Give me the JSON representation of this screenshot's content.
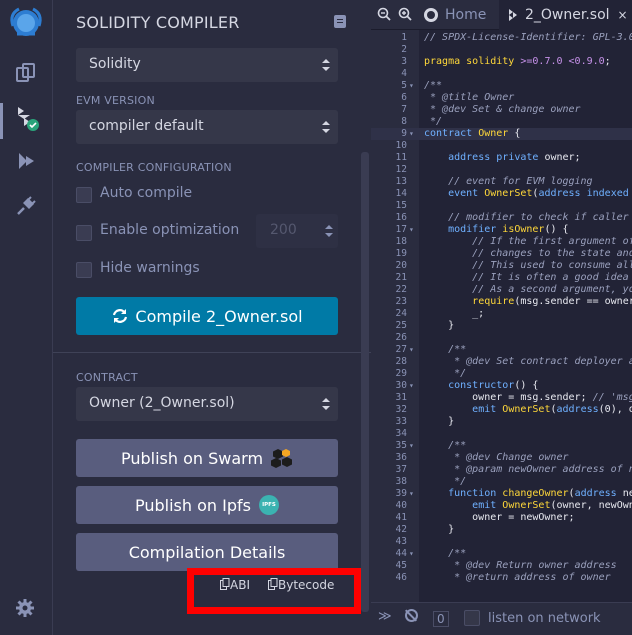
{
  "icon_panel": {
    "items": [
      {
        "name": "file-explorers-icon"
      },
      {
        "name": "solidity-compiler-icon"
      },
      {
        "name": "deploy-run-icon"
      },
      {
        "name": "plugin-manager-icon"
      }
    ],
    "settings_icon": "gear-icon"
  },
  "compiler": {
    "title": "SOLIDITY COMPILER",
    "language": "Solidity",
    "evm_label": "EVM VERSION",
    "evm_value": "compiler default",
    "config_label": "COMPILER CONFIGURATION",
    "auto_compile": "Auto compile",
    "enable_optimization": "Enable optimization",
    "optimization_runs": "200",
    "hide_warnings": "Hide warnings",
    "compile_button": "Compile 2_Owner.sol",
    "contract_label": "CONTRACT",
    "contract_value": "Owner (2_Owner.sol)",
    "publish_swarm": "Publish on Swarm",
    "publish_ipfs": "Publish on Ipfs",
    "ipfs_badge": "IPFS",
    "compilation_details": "Compilation Details",
    "abi": "ABI",
    "bytecode": "Bytecode"
  },
  "editor": {
    "tabs": [
      {
        "label": "Home"
      },
      {
        "label": "2_Owner.sol"
      }
    ],
    "lines": [
      {
        "n": "1",
        "fold": "",
        "t": "// SPDX-License-Identifier: GPL-3.0"
      },
      {
        "n": "2",
        "fold": "",
        "t": ""
      },
      {
        "n": "3",
        "fold": "",
        "t": "pragma solidity >=0.7.0 <0.9.0;"
      },
      {
        "n": "4",
        "fold": "",
        "t": ""
      },
      {
        "n": "5",
        "fold": "▾",
        "t": "/**"
      },
      {
        "n": "6",
        "fold": "",
        "t": " * @title Owner"
      },
      {
        "n": "7",
        "fold": "",
        "t": " * @dev Set & change owner"
      },
      {
        "n": "8",
        "fold": "",
        "t": " */"
      },
      {
        "n": "9",
        "fold": "▾",
        "t": "contract Owner {"
      },
      {
        "n": "10",
        "fold": "",
        "t": ""
      },
      {
        "n": "11",
        "fold": "",
        "t": "    address private owner;"
      },
      {
        "n": "12",
        "fold": "",
        "t": ""
      },
      {
        "n": "13",
        "fold": "",
        "t": "    // event for EVM logging"
      },
      {
        "n": "14",
        "fold": "",
        "t": "    event OwnerSet(address indexed oldOwner, address indexed newOwner);"
      },
      {
        "n": "15",
        "fold": "",
        "t": ""
      },
      {
        "n": "16",
        "fold": "",
        "t": "    // modifier to check if caller is owner"
      },
      {
        "n": "17",
        "fold": "▾",
        "t": "    modifier isOwner() {"
      },
      {
        "n": "18",
        "fold": "",
        "t": "        // If the first argument of 'require' evaluates to 'false', execution terminates and all"
      },
      {
        "n": "19",
        "fold": "",
        "t": "        // changes to the state and to Ether balances are reverted."
      },
      {
        "n": "20",
        "fold": "",
        "t": "        // This used to consume all gas in old EVM versions, but not anymore."
      },
      {
        "n": "21",
        "fold": "",
        "t": "        // It is often a good idea to use 'require' to check if functions are called correctly."
      },
      {
        "n": "22",
        "fold": "",
        "t": "        // As a second argument, you can also provide an explanation about what went wrong."
      },
      {
        "n": "23",
        "fold": "",
        "t": "        require(msg.sender == owner, \"Caller is not owner\");"
      },
      {
        "n": "24",
        "fold": "",
        "t": "        _;"
      },
      {
        "n": "25",
        "fold": "",
        "t": "    }"
      },
      {
        "n": "26",
        "fold": "",
        "t": ""
      },
      {
        "n": "27",
        "fold": "▾",
        "t": "    /**"
      },
      {
        "n": "28",
        "fold": "",
        "t": "     * @dev Set contract deployer as owner"
      },
      {
        "n": "29",
        "fold": "",
        "t": "     */"
      },
      {
        "n": "30",
        "fold": "▾",
        "t": "    constructor() {"
      },
      {
        "n": "31",
        "fold": "",
        "t": "        owner = msg.sender; // 'msg.sender' is sender of current call"
      },
      {
        "n": "32",
        "fold": "",
        "t": "        emit OwnerSet(address(0), owner);"
      },
      {
        "n": "33",
        "fold": "",
        "t": "    }"
      },
      {
        "n": "34",
        "fold": "",
        "t": ""
      },
      {
        "n": "35",
        "fold": "▾",
        "t": "    /**"
      },
      {
        "n": "36",
        "fold": "",
        "t": "     * @dev Change owner"
      },
      {
        "n": "37",
        "fold": "",
        "t": "     * @param newOwner address of new owner"
      },
      {
        "n": "38",
        "fold": "",
        "t": "     */"
      },
      {
        "n": "39",
        "fold": "▾",
        "t": "    function changeOwner(address newOwner) public isOwner {"
      },
      {
        "n": "40",
        "fold": "",
        "t": "        emit OwnerSet(owner, newOwner);"
      },
      {
        "n": "41",
        "fold": "",
        "t": "        owner = newOwner;"
      },
      {
        "n": "42",
        "fold": "",
        "t": "    }"
      },
      {
        "n": "43",
        "fold": "",
        "t": ""
      },
      {
        "n": "44",
        "fold": "▾",
        "t": "    /**"
      },
      {
        "n": "45",
        "fold": "",
        "t": "     * @dev Return owner address"
      },
      {
        "n": "46",
        "fold": "",
        "t": "     * @return address of owner"
      }
    ]
  },
  "terminal": {
    "count": "0",
    "listen_label": "listen on network"
  },
  "colors": {
    "compile_button": "#007aa6",
    "publish_button": "#595d7e",
    "highlight": "#ff0000"
  }
}
